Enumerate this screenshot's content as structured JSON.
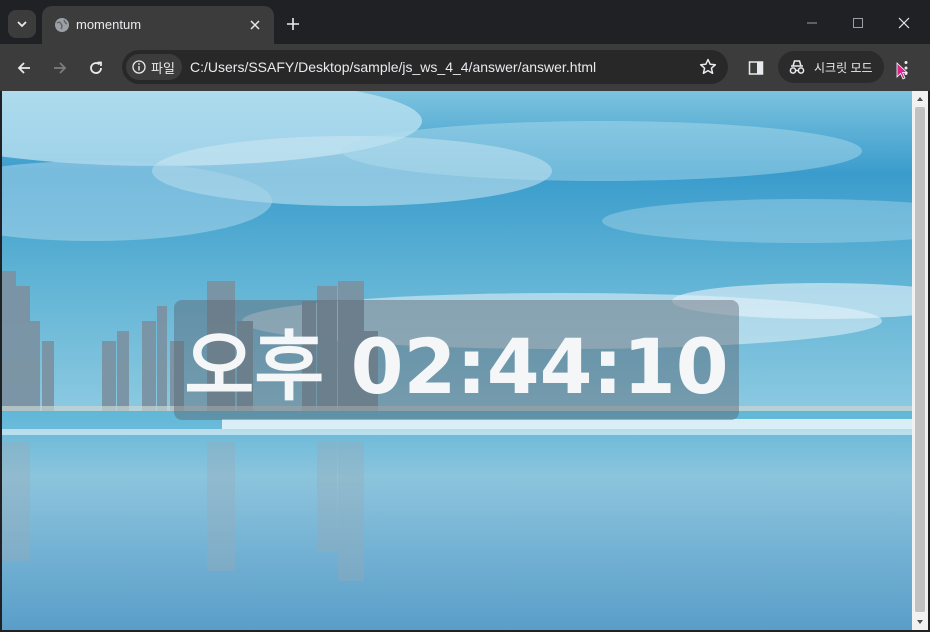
{
  "browser": {
    "tab_title": "momentum",
    "site_chip_label": "파일",
    "url": "C:/Users/SSAFY/Desktop/sample/js_ws_4_4/answer/answer.html",
    "incognito_label": "시크릿 모드"
  },
  "page": {
    "clock_text": "오후 02:44:10"
  },
  "icons": {
    "tab_search": "chevron-down-icon",
    "favicon": "globe-icon",
    "tab_close": "close-icon",
    "new_tab": "plus-icon",
    "minimize": "minimize-icon",
    "maximize": "maximize-icon",
    "close": "close-icon",
    "back": "back-arrow-icon",
    "forward": "forward-arrow-icon",
    "reload": "reload-icon",
    "info": "info-icon",
    "bookmark": "star-icon",
    "side_panel": "side-panel-icon",
    "incognito": "incognito-icon",
    "menu": "kebab-menu-icon"
  },
  "colors": {
    "frame": "#202124",
    "toolbar": "#3c3c3c",
    "omnibox": "#282828",
    "sky": "#3aa6d0",
    "water": "#6fb3d6",
    "clock_text": "#f4f6f8"
  }
}
